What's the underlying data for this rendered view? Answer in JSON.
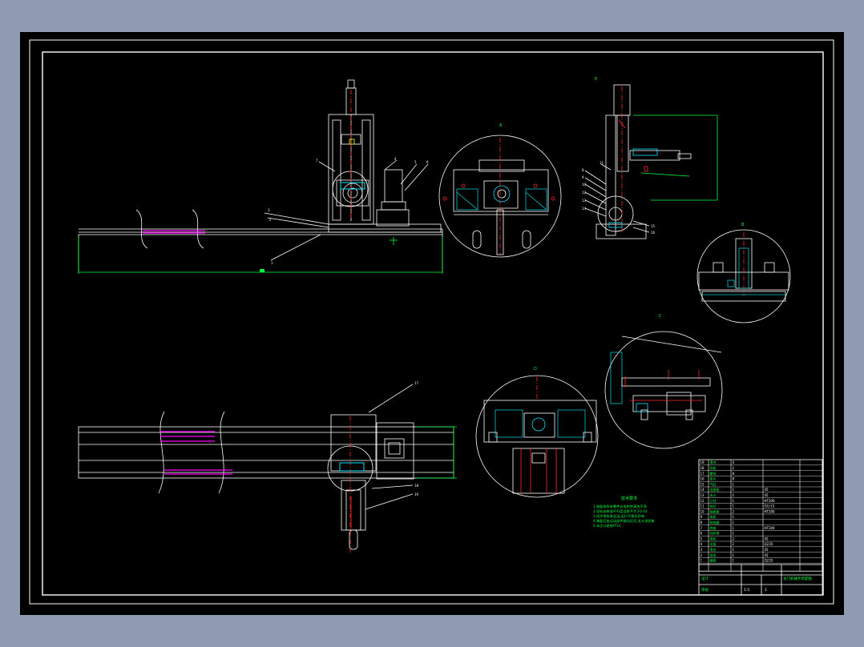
{
  "colors": {
    "desktop": "#8e9bb0",
    "paper": "#000000",
    "outline": "#ffffff",
    "dimension": "#00ff3c",
    "highlight": "#ff00ff",
    "centerline": "#ff2a2a",
    "cyan": "#00e5ff",
    "yellow": "#ffff00",
    "hatch": "#00c8d0"
  },
  "section_marks": {
    "detail_a": "A",
    "detail_b": "B",
    "detail_c": "C",
    "detail_d": "D",
    "detail_e": "E"
  },
  "leader_labels": [
    "1",
    "2",
    "3",
    "4",
    "5",
    "6",
    "7",
    "8",
    "9",
    "10",
    "11",
    "12",
    "13",
    "14",
    "15",
    "16",
    "17",
    "18",
    "19"
  ],
  "notes": {
    "title": "技术要求",
    "lines": [
      "1.装配前所有零件去毛刺并清洗干净",
      "2.导轨安装面平行度误差不大于0.02",
      "3.同步带张紧适当,运行平稳无异响",
      "4.装配后各运动部件移动灵活,无卡滞现象",
      "5.未注公差按IT14"
    ]
  },
  "bom_rows": [
    [
      "19",
      "滑块",
      "4",
      ""
    ],
    [
      "18",
      "导轨",
      "2",
      ""
    ],
    [
      "17",
      "螺母",
      "8",
      ""
    ],
    [
      "16",
      "垫片",
      "8",
      ""
    ],
    [
      "15",
      "气缸",
      "1",
      ""
    ],
    [
      "14",
      "连接板",
      "1",
      "45"
    ],
    [
      "13",
      "夹爪",
      "2",
      "45"
    ],
    [
      "12",
      "立柱",
      "1",
      "HT200"
    ],
    [
      "11",
      "丝杠",
      "1",
      "GCr15"
    ],
    [
      "10",
      "轴承座",
      "2",
      "HT200"
    ],
    [
      "9",
      "电机",
      "1",
      ""
    ],
    [
      "8",
      "联轴器",
      "1",
      ""
    ],
    [
      "7",
      "底座",
      "1",
      "HT200"
    ],
    [
      "6",
      "同步带",
      "1",
      ""
    ],
    [
      "5",
      "带轮",
      "2",
      "45"
    ],
    [
      "4",
      "支架",
      "2",
      "Q235"
    ],
    [
      "3",
      "滑台",
      "1",
      "45"
    ],
    [
      "2",
      "齿条",
      "1",
      "45"
    ],
    [
      "1",
      "横梁",
      "1",
      "Q235"
    ]
  ],
  "title_block": {
    "drawing_name": "龙门机械手装配图",
    "scale": "1:5",
    "sheet": "1",
    "designer": "设计",
    "checker": "审核"
  }
}
